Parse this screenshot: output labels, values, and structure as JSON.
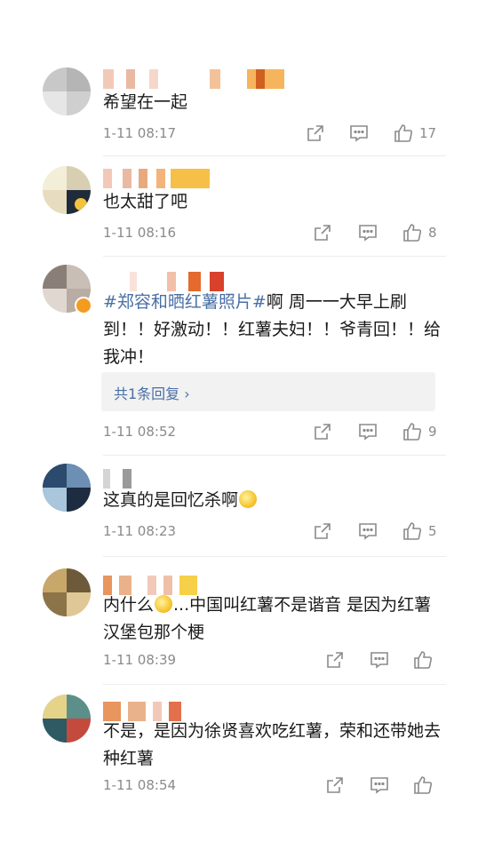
{
  "comments": [
    {
      "text": "希望在一起",
      "time": "1-11 08:17",
      "likes": "17"
    },
    {
      "text": "也太甜了吧",
      "time": "1-11 08:16",
      "likes": "8"
    },
    {
      "topic": "#郑容和晒红薯照片#",
      "text": "啊 周一一大早上刷到！！好激动！！红薯夫妇！！爷青回！！给我冲！",
      "reply_label": "共1条回复 ›",
      "time": "1-11 08:52",
      "likes": "9"
    },
    {
      "text": "这真的是回忆杀啊",
      "time": "1-11 08:23",
      "likes": "5"
    },
    {
      "text_a": "内什么",
      "text_b": "...中国叫红薯不是谐音 是因为红薯汉堡包那个梗",
      "time": "1-11 08:39",
      "likes": ""
    },
    {
      "text": "不是，是因为徐贤喜欢吃红薯，荣和还带她去种红薯",
      "time": "1-11 08:54",
      "likes": ""
    }
  ],
  "icons": [
    "share-icon",
    "comment-icon",
    "like-icon",
    "emoji-laugh-icon",
    "emoji-cry-icon"
  ],
  "colors": {
    "topic": "#4a6fa5",
    "meta": "#8a8a8a",
    "text": "#1a1a1a"
  }
}
